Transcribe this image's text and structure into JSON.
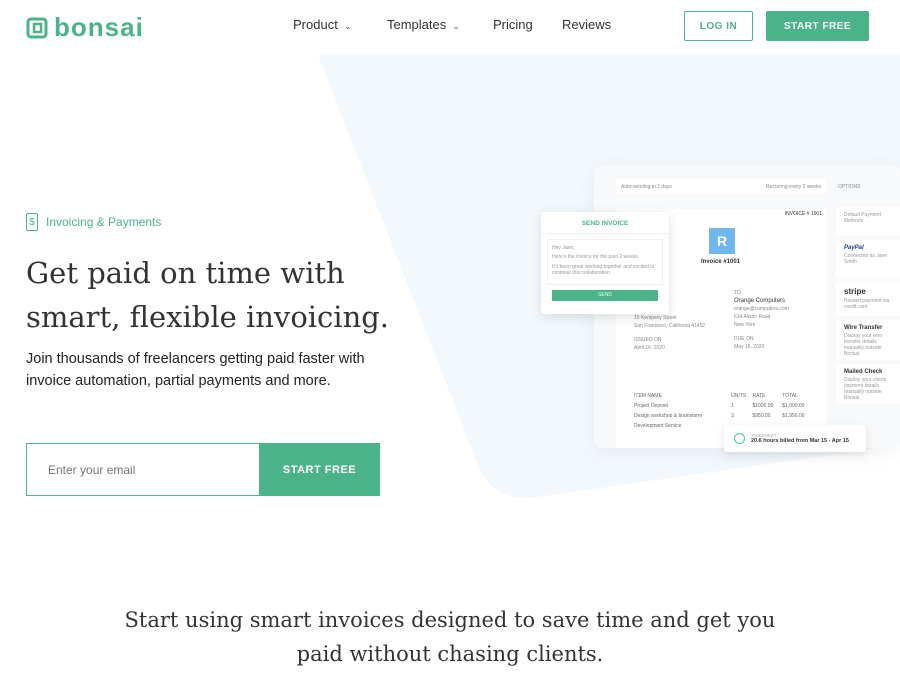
{
  "brand": {
    "name": "bonsai",
    "color": "#4bb38a"
  },
  "nav": {
    "items": [
      {
        "label": "Product",
        "dropdown": true
      },
      {
        "label": "Templates",
        "dropdown": true
      },
      {
        "label": "Pricing"
      },
      {
        "label": "Reviews"
      }
    ],
    "login": "LOG IN",
    "start": "START FREE"
  },
  "hero": {
    "tag": "Invoicing & Payments",
    "title": "Get paid on time with smart, flexible invoicing.",
    "subtitle": "Join thousands of freelancers getting paid faster with invoice automation, partial payments and more.",
    "email_placeholder": "Enter your email",
    "cta": "START FREE"
  },
  "mockup": {
    "auto": "Auto-sending in 2 days",
    "recurring": "Recurring every 2 weeks",
    "options": "OPTIONS",
    "invoice_no": "INVOICE # 1001",
    "logo_letter": "R",
    "invoice_title": "Invoice #1001",
    "to_label": "TO",
    "client": "Orange Computers",
    "client_email": "orange@computers.com",
    "client_addr": "614 Alison Road",
    "client_city": "New York",
    "from_addr": "15 Kempsey Street",
    "from_city": "San Francisco, California 41452",
    "issued_label": "ISSUED ON",
    "issued": "April 16, 2020",
    "due_label": "DUE ON",
    "due": "May 16, 2020",
    "columns": [
      "ITEM NAME",
      "UNITS",
      "RATE",
      "TOTAL"
    ],
    "rows": [
      [
        "Project Deposit",
        "1",
        "$1000.00",
        "$1,000.00"
      ],
      [
        "Design workshop & brainstorm",
        "3",
        "$950.00",
        "$1,950.00"
      ],
      [
        "Development Service",
        "",
        "",
        ""
      ]
    ],
    "methods_label": "Default Payment Methods",
    "methods": [
      {
        "name": "PayPal",
        "desc": "Connected as Jane Smith"
      },
      {
        "name": "stripe",
        "desc": "Paused payment via credit card"
      },
      {
        "name": "Wire Transfer",
        "desc": "Display your wire transfer details manually outside Bonsai"
      },
      {
        "name": "Mailed Check",
        "desc": "Display your check payment details manually outside Bonsai"
      }
    ],
    "send": {
      "title": "SEND INVOICE",
      "greeting": "Hey Jane,",
      "line1": "Here's the invoice for the past 2 weeks.",
      "line2": "It's been great working together and excited to continue this collaboration",
      "button": "SEND"
    },
    "timesheet": {
      "label": "TIMESHEET",
      "text": "20.6 hours billed from Mar 15 - Apr 15"
    }
  },
  "section": {
    "heading": "Start using smart invoices designed to save time and get you paid without chasing clients."
  }
}
